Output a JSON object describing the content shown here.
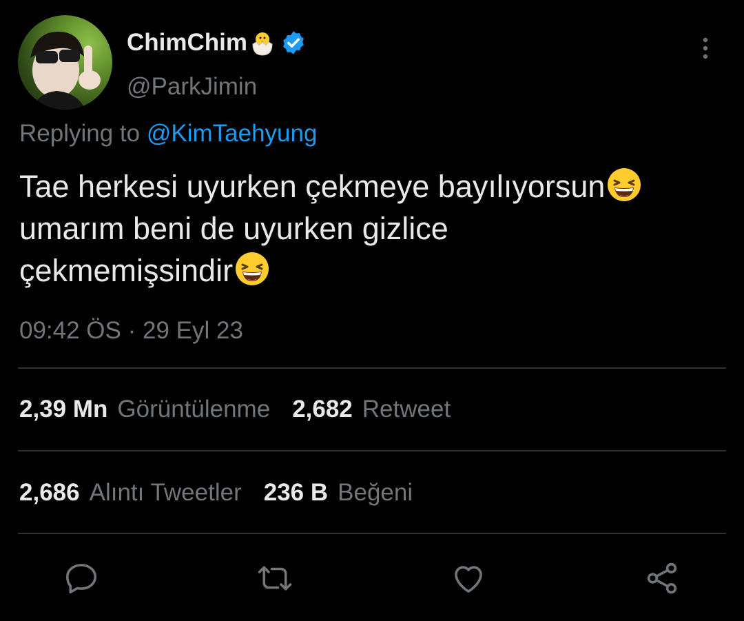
{
  "author": {
    "display_name": "ChimChim",
    "handle": "@ParkJimin",
    "verified": true,
    "avatar_icon": "profile-photo",
    "name_emoji": "hatching-chick"
  },
  "reply": {
    "prefix": "Replying to",
    "mention": "@KimTaehyung"
  },
  "tweet": {
    "line1": "Tae herkesi uyurken çekmeye bayılıyorsun",
    "line2": "umarım beni de uyurken gizlice",
    "line3": "çekmemişsindir",
    "emoji": "grinning-squinting-face"
  },
  "timestamp": "09:42 ÖS · 29 Eyl 23",
  "stats": {
    "views_count": "2,39 Mn",
    "views_label": "Görüntülenme",
    "retweets_count": "2,682",
    "retweets_label": "Retweet",
    "quotes_count": "2,686",
    "quotes_label": "Alıntı Tweetler",
    "likes_count": "236 B",
    "likes_label": "Beğeni"
  },
  "actions": [
    "reply-icon",
    "retweet-icon",
    "like-icon",
    "share-icon"
  ],
  "colors": {
    "background": "#000000",
    "text": "#e7e9ea",
    "secondary": "#71767b",
    "accent": "#1d9bf0",
    "divider": "#2f3336"
  }
}
